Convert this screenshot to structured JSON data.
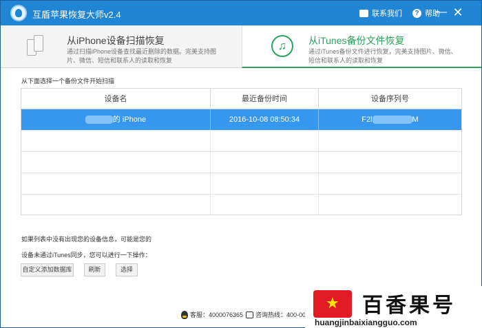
{
  "window": {
    "title": "互盾苹果恢复大师v2.4",
    "contact_label": "联系我们",
    "help_label": "帮助",
    "minimize_glyph": "—",
    "close_glyph": "✕"
  },
  "modes": [
    {
      "title": "从iPhone设备扫描恢复",
      "desc": "通过扫描iPhone设备查找最近删除的数据。完美支持图片、微信、短信和联系人的读取和恢复",
      "icon": "phone-icon",
      "active": false
    },
    {
      "title": "从iTunes备份文件恢复",
      "desc": "通过iTunes备份文件进行恢复，完美支持图片、微信、短信和联系人的读取和恢复",
      "icon": "music-note-icon",
      "active": true
    }
  ],
  "hint": "从下面选择一个备份文件开始扫描",
  "table": {
    "columns": [
      "设备名",
      "最近备份时间",
      "设备序列号"
    ],
    "rows": [
      {
        "name_suffix": "的 iPhone",
        "time": "2016-10-08  08:50:34",
        "serial_prefix": "F2l",
        "serial_suffix": "M",
        "selected": true
      }
    ],
    "empty_rows": 4
  },
  "notes": {
    "line1": "如果列表中没有出现您的设备信息，可能是您的",
    "line2": "设备未通过iTunes同步，您可以进行一下操作："
  },
  "buttons": {
    "custom": "自定义添加数据库",
    "refresh": "刷新",
    "select": "选择"
  },
  "footer": {
    "service": "客服：4000076365",
    "hotline": "咨询热线：400-007-63"
  },
  "watermark": {
    "name": "百香果号",
    "url": "huangjinbaixiangguo.com"
  },
  "colors": {
    "titlebar": "#1f85d4",
    "selected_row": "#3697ee",
    "accent_green": "#29a35a"
  }
}
